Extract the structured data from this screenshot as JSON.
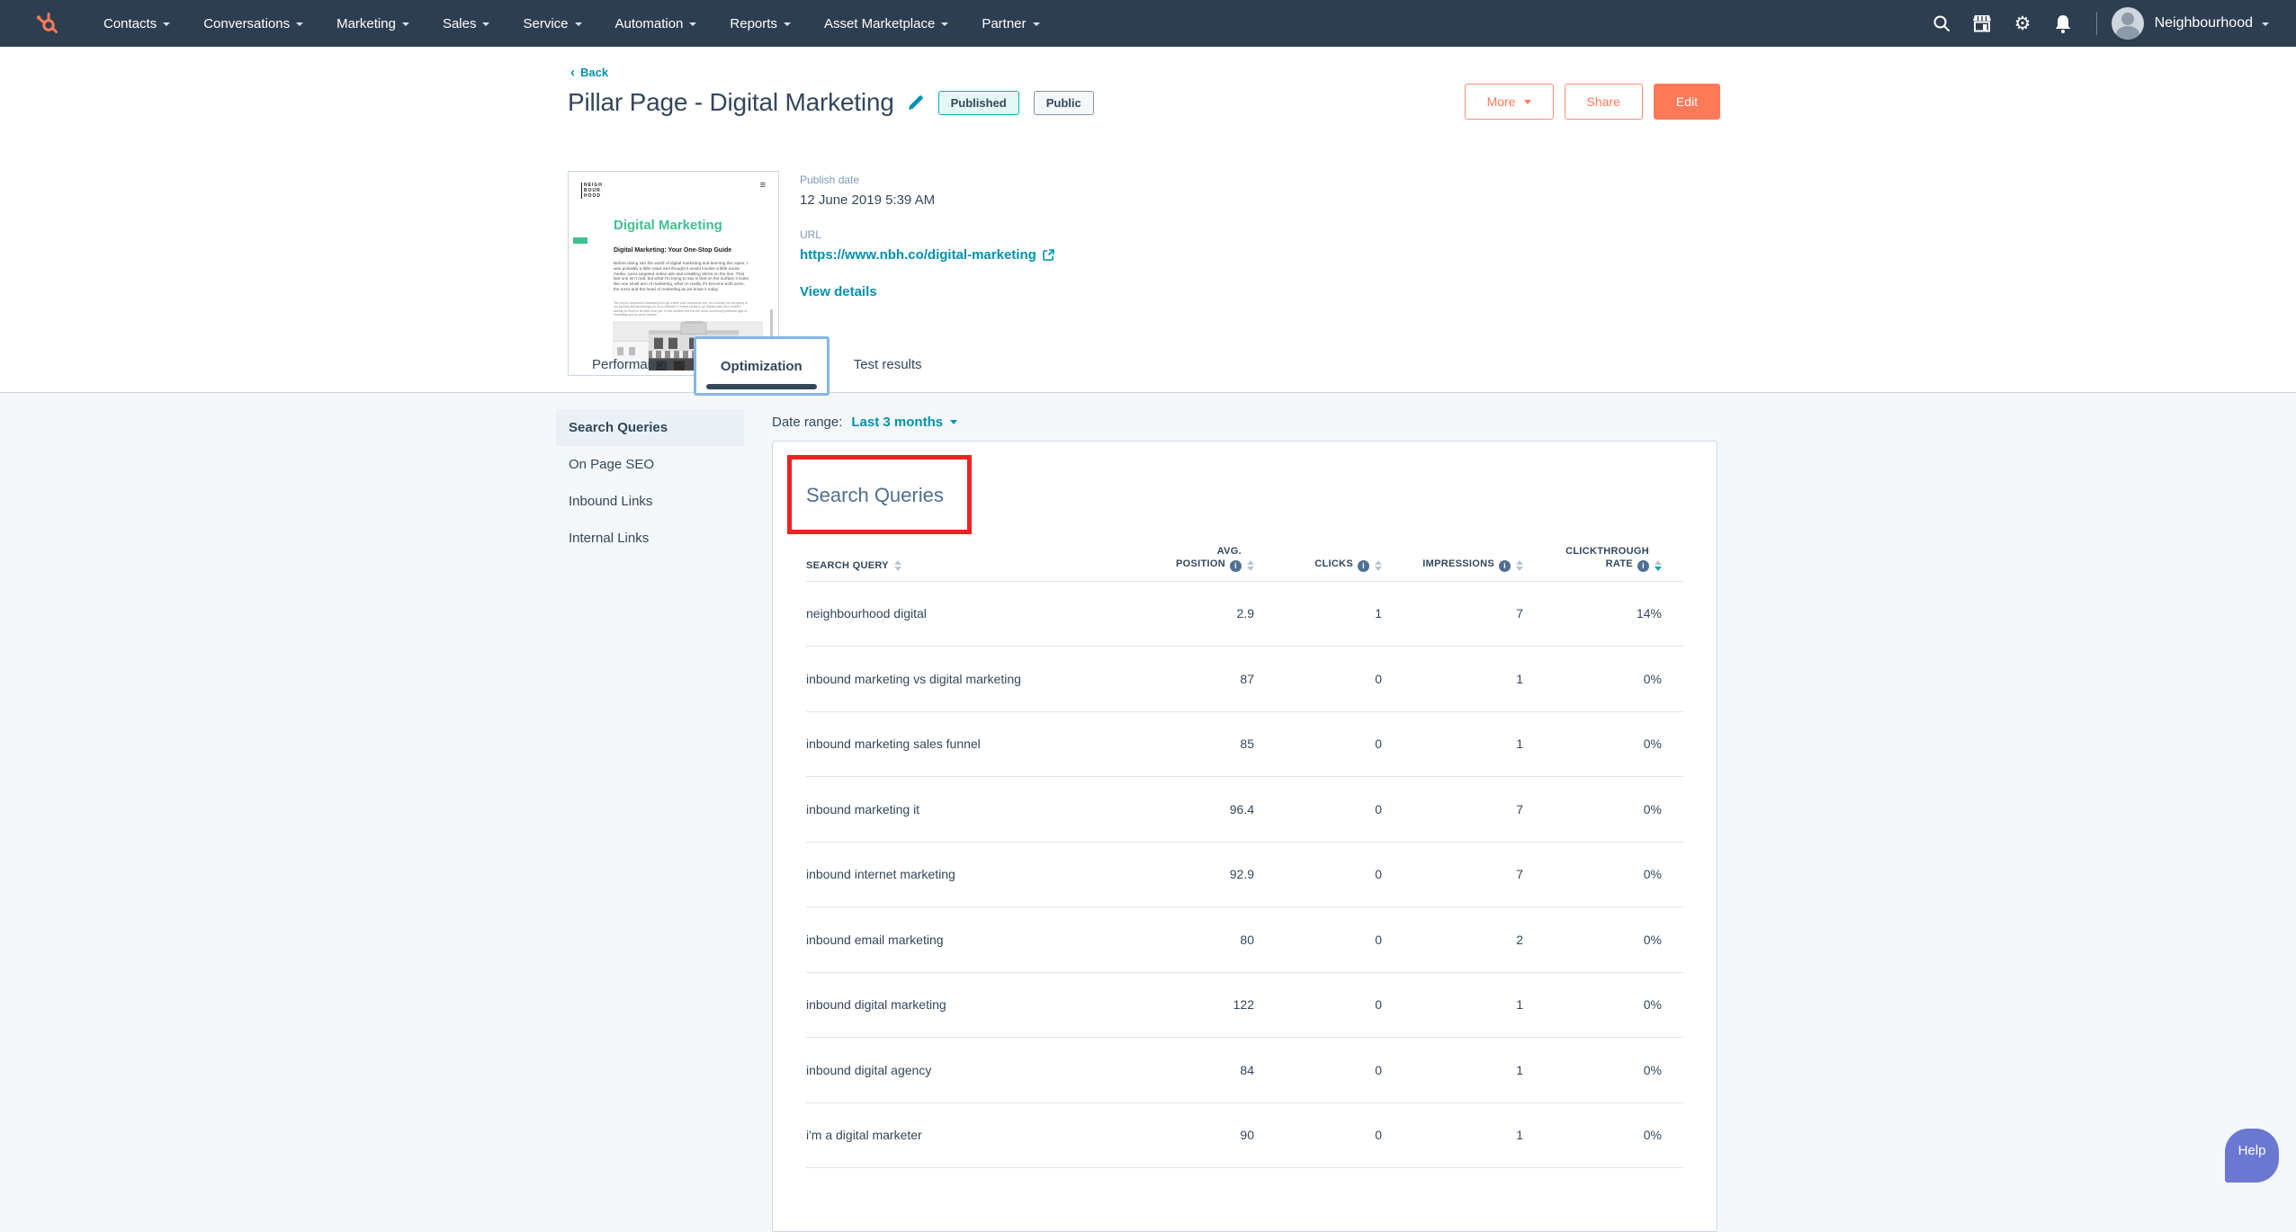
{
  "nav": {
    "items": [
      "Contacts",
      "Conversations",
      "Marketing",
      "Sales",
      "Service",
      "Automation",
      "Reports",
      "Asset Marketplace",
      "Partner"
    ],
    "icons": [
      "search",
      "marketplace",
      "settings",
      "notifications"
    ],
    "account_name": "Neighbourhood"
  },
  "header": {
    "back_label": "Back",
    "title": "Pillar Page - Digital Marketing",
    "status_badge": "Published",
    "visibility_badge": "Public",
    "more_label": "More",
    "share_label": "Share",
    "edit_label": "Edit",
    "publish_date_label": "Publish date",
    "publish_date_value": "12 June 2019 5:39 AM",
    "url_label": "URL",
    "url_value": "https://www.nbh.co/digital-marketing",
    "view_details_label": "View details"
  },
  "preview": {
    "logo_line1": "NEIGH",
    "logo_line2": "BOUR",
    "logo_line3": "HOOD",
    "menu_glyph": "≡",
    "heading": "Digital Marketing",
    "subheading": "Digital Marketing: Your One-Stop Guide",
    "para1": "Before diving into the world of digital marketing and learning the ropes, I was probably a little naive and thought it would involve a little social media, some targeted online ads and installing SEOs on the line. That last one isn't real, but what I'm trying to say is that on the surface it looks like one small arm of marketing, when in reality it's become both arms, the torso and the head of marketing as we know it today.",
    "para2": "The key to successful marketing is to go where your customers are, as a society we are glued to our phones and technology so as a marketer it makes sense to go digital, take your content directly to them or let them find you. In the modern era it is the most commonly practiced type of marketing and for good reason."
  },
  "tabs": [
    {
      "label": "Performance",
      "active": false
    },
    {
      "label": "Optimization",
      "active": true
    },
    {
      "label": "Test results",
      "active": false
    }
  ],
  "sidebar": {
    "items": [
      {
        "label": "Search Queries",
        "active": true
      },
      {
        "label": "On Page SEO",
        "active": false
      },
      {
        "label": "Inbound Links",
        "active": false
      },
      {
        "label": "Internal Links",
        "active": false
      }
    ]
  },
  "main": {
    "date_range_label": "Date range:",
    "date_range_value": "Last 3 months",
    "section_title": "Search Queries",
    "table": {
      "columns": [
        "SEARCH QUERY",
        "AVG. POSITION",
        "CLICKS",
        "IMPRESSIONS",
        "CLICKTHROUGH RATE"
      ],
      "sorted_by": "CLICKTHROUGH RATE",
      "sort_direction": "desc",
      "rows": [
        {
          "query": "neighbourhood digital",
          "avg_position": "2.9",
          "clicks": "1",
          "impressions": "7",
          "ctr": "14%"
        },
        {
          "query": "inbound marketing vs digital marketing",
          "avg_position": "87",
          "clicks": "0",
          "impressions": "1",
          "ctr": "0%"
        },
        {
          "query": "inbound marketing sales funnel",
          "avg_position": "85",
          "clicks": "0",
          "impressions": "1",
          "ctr": "0%"
        },
        {
          "query": "inbound marketing it",
          "avg_position": "96.4",
          "clicks": "0",
          "impressions": "7",
          "ctr": "0%"
        },
        {
          "query": "inbound internet marketing",
          "avg_position": "92.9",
          "clicks": "0",
          "impressions": "7",
          "ctr": "0%"
        },
        {
          "query": "inbound email marketing",
          "avg_position": "80",
          "clicks": "0",
          "impressions": "2",
          "ctr": "0%"
        },
        {
          "query": "inbound digital marketing",
          "avg_position": "122",
          "clicks": "0",
          "impressions": "1",
          "ctr": "0%"
        },
        {
          "query": "inbound digital agency",
          "avg_position": "84",
          "clicks": "0",
          "impressions": "1",
          "ctr": "0%"
        },
        {
          "query": "i'm a digital marketer",
          "avg_position": "90",
          "clicks": "0",
          "impressions": "1",
          "ctr": "0%"
        }
      ]
    }
  },
  "help": {
    "label": "Help"
  },
  "colors": {
    "nav_bg": "#2d3e50",
    "accent_orange": "#ff7a59",
    "link_teal": "#0091ae",
    "published_green": "#00bda5",
    "annotation_red": "#ee2222",
    "help_purple": "#6a78d1",
    "preview_green": "#3ec28f"
  }
}
